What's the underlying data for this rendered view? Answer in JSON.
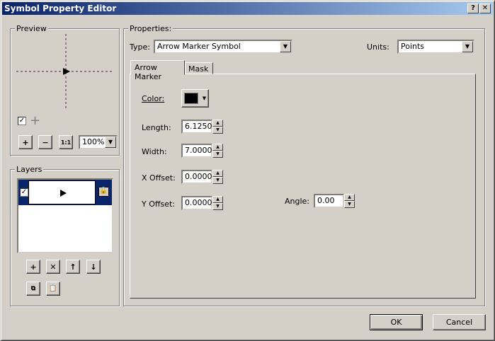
{
  "window": {
    "title": "Symbol Property Editor",
    "help": "?",
    "close": "✕"
  },
  "preview": {
    "label": "Preview",
    "zoom": "100%",
    "zoom_in": "+",
    "zoom_out": "−",
    "fit": "1:1"
  },
  "layers": {
    "label": "Layers",
    "add": "+",
    "remove": "✕",
    "up": "↑",
    "down": "↓"
  },
  "properties": {
    "label": "Properties:",
    "type_label": "Type:",
    "type_value": "Arrow Marker Symbol",
    "units_label": "Units:",
    "units_value": "Points"
  },
  "tabs": [
    {
      "label": "Arrow Marker"
    },
    {
      "label": "Mask"
    }
  ],
  "fields": {
    "color_label": "Color:",
    "color": "#000000",
    "length_label": "Length:",
    "length": "6.1250",
    "width_label": "Width:",
    "width": "7.0000",
    "xoffset_label": "X Offset:",
    "xoffset": "0.0000",
    "yoffset_label": "Y Offset:",
    "yoffset": "0.0000",
    "angle_label": "Angle:",
    "angle": "0.00"
  },
  "buttons": {
    "ok": "OK",
    "cancel": "Cancel"
  }
}
